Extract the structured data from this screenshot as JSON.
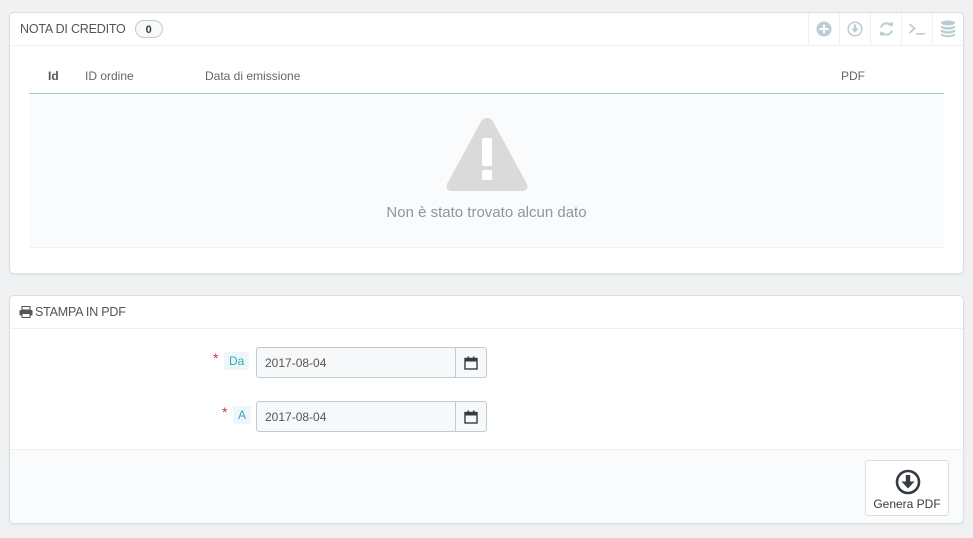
{
  "credit_panel": {
    "title": "NOTA DI CREDITO",
    "count": "0",
    "toolbar": [
      {
        "icon": "plus-circle-icon"
      },
      {
        "icon": "download-circle-icon"
      },
      {
        "icon": "refresh-icon"
      },
      {
        "icon": "terminal-icon"
      },
      {
        "icon": "database-icon"
      }
    ],
    "columns": [
      "Id",
      "ID ordine",
      "Data di emissione",
      "PDF"
    ],
    "empty_message": "Non è stato trovato alcun dato"
  },
  "pdf_panel": {
    "title": "STAMPA IN PDF",
    "from": {
      "label": "Da",
      "value": "2017-08-04"
    },
    "to": {
      "label": "A",
      "value": "2017-08-04"
    },
    "generate_label": "Genera PDF"
  },
  "colors": {
    "accent": "#3aa5c1",
    "required": "#e3283d",
    "table_border": "#92d1c6"
  }
}
